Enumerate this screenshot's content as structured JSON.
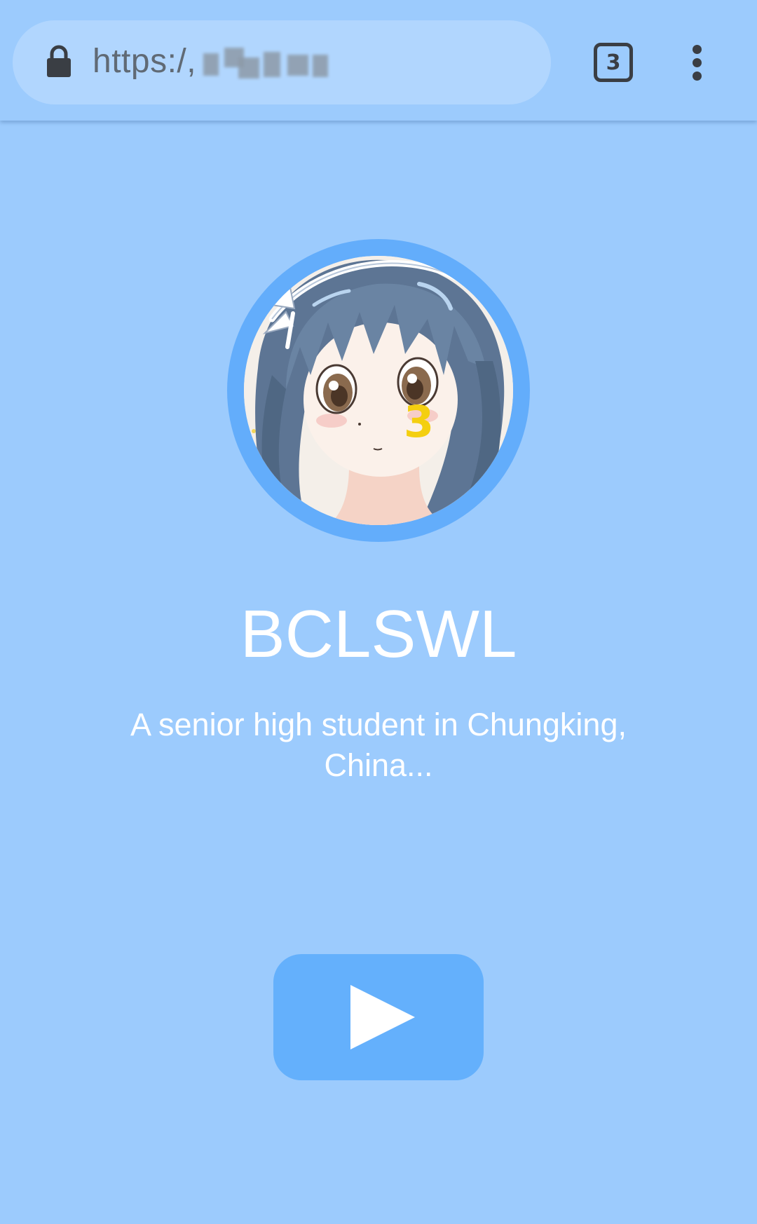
{
  "browser": {
    "url_visible": "https:/,",
    "tab_count": "3",
    "lock_icon": "lock-icon",
    "menu_icon": "more-vert-icon"
  },
  "profile": {
    "name": "BCLSWL",
    "bio": "A senior high student in Chungking, China...",
    "avatar_badge": "3"
  },
  "actions": {
    "play_icon": "play-icon"
  },
  "colors": {
    "background": "#9ccbfd",
    "urlbar": "#b1d6fe",
    "avatar_ring": "#63adfb",
    "play_button": "#64b0fc",
    "text": "#ffffff"
  }
}
